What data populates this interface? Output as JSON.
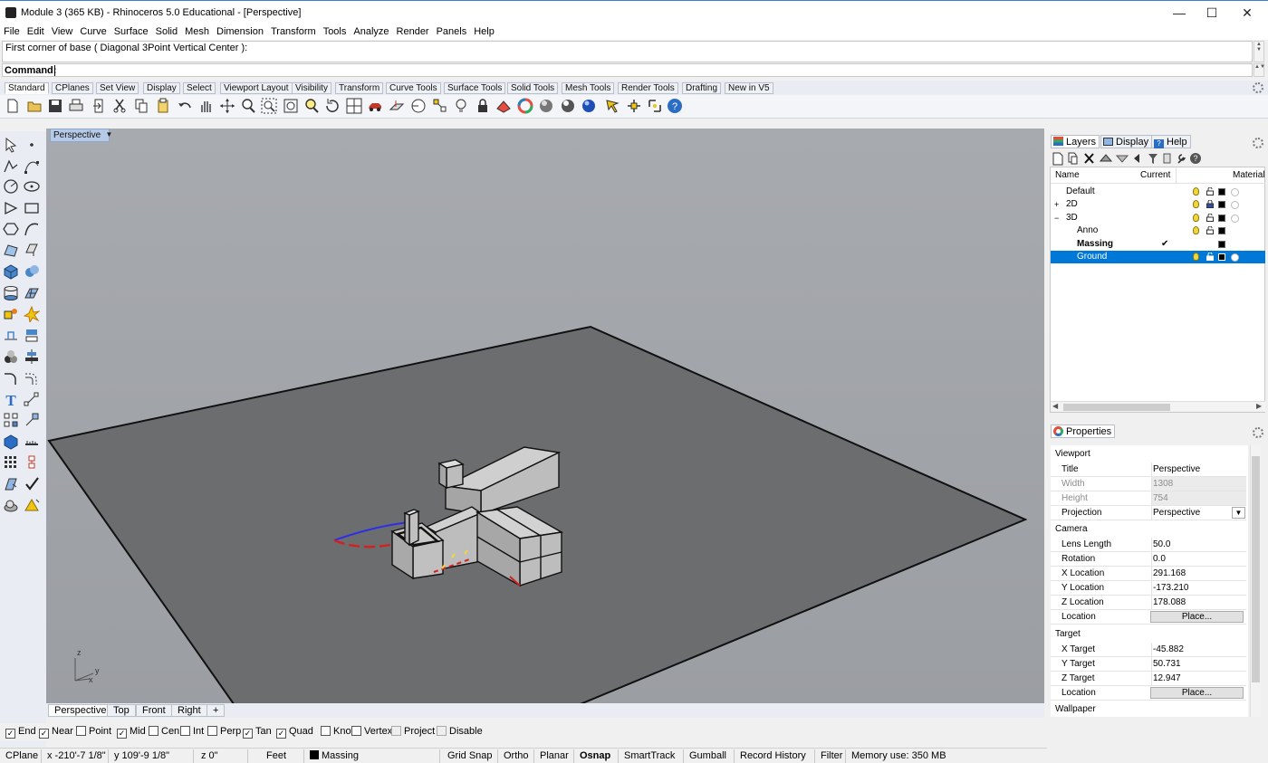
{
  "window": {
    "title": "Module 3 (365 KB) - Rhinoceros 5.0 Educational - [Perspective]",
    "minimize": "—",
    "maximize": "☐",
    "close": "✕"
  },
  "menu": [
    "File",
    "Edit",
    "View",
    "Curve",
    "Surface",
    "Solid",
    "Mesh",
    "Dimension",
    "Transform",
    "Tools",
    "Analyze",
    "Render",
    "Panels",
    "Help"
  ],
  "command": {
    "history": "First corner of base ( Diagonal  3Point  Vertical  Center ):",
    "label": "Command:"
  },
  "toolbar_tabs": [
    "Standard",
    "CPlanes",
    "Set View",
    "Display",
    "Select",
    "Viewport Layout",
    "Visibility",
    "Transform",
    "Curve Tools",
    "Surface Tools",
    "Solid Tools",
    "Mesh Tools",
    "Render Tools",
    "Drafting",
    "New in V5"
  ],
  "toolbar_icons": [
    "new-file-icon",
    "open-folder-icon",
    "save-icon",
    "print-icon",
    "import-icon",
    "cut-icon",
    "copy-icon",
    "paste-icon",
    "undo-icon",
    "pan-hand-icon",
    "rotate-view-icon",
    "zoom-dynamic-icon",
    "zoom-window-icon",
    "zoom-extents-icon",
    "zoom-selected-icon",
    "rotate-icon",
    "four-viewports-icon",
    "car-icon",
    "cplane-icon",
    "circle-point-icon",
    "object-snap-icon",
    "light-bulb-icon",
    "lock-icon",
    "render-preview-icon",
    "color-wheel-icon",
    "shaded-sphere-icon",
    "rendered-sphere-icon",
    "material-sphere-icon",
    "blue-sphere-icon",
    "arrow-pin-icon",
    "properties-icon",
    "options-icon",
    "help-icon"
  ],
  "viewport": {
    "label": "Perspective",
    "axes": {
      "z": "z",
      "y": "y",
      "x": "x"
    }
  },
  "viewport_tabs": [
    "Perspective",
    "Top",
    "Front",
    "Right"
  ],
  "viewport_tab_add": "+",
  "osnaps": [
    {
      "label": "End",
      "checked": true
    },
    {
      "label": "Near",
      "checked": true
    },
    {
      "label": "Point",
      "checked": false
    },
    {
      "label": "Mid",
      "checked": true
    },
    {
      "label": "Cen",
      "checked": false
    },
    {
      "label": "Int",
      "checked": false
    },
    {
      "label": "Perp",
      "checked": false
    },
    {
      "label": "Tan",
      "checked": true
    },
    {
      "label": "Quad",
      "checked": true
    },
    {
      "label": "Knot",
      "checked": false
    },
    {
      "label": "Vertex",
      "checked": false
    },
    {
      "label": "Project",
      "checked": false
    },
    {
      "label": "Disable",
      "checked": false
    }
  ],
  "status": {
    "cplane": "CPlane",
    "x": "x -210'-7 1/8\"",
    "y": "y 109'-9 1/8\"",
    "z": "z 0\"",
    "units": "Feet",
    "layer": "Massing",
    "grid_snap": "Grid Snap",
    "ortho": "Ortho",
    "planar": "Planar",
    "osnap": "Osnap",
    "smarttrack": "SmartTrack",
    "gumball": "Gumball",
    "record_history": "Record History",
    "filter": "Filter",
    "memory": "Memory use: 350 MB"
  },
  "layers_panel": {
    "tabs": [
      "Layers",
      "Display",
      "Help"
    ],
    "headers": {
      "name": "Name",
      "current": "Current",
      "material": "Material"
    },
    "rows": [
      {
        "name": "Default",
        "indent": 0,
        "expander": "",
        "current": "",
        "bold": false,
        "selected": false
      },
      {
        "name": "2D",
        "indent": 0,
        "expander": "+",
        "current": "",
        "bold": false,
        "selected": false
      },
      {
        "name": "3D",
        "indent": 0,
        "expander": "−",
        "current": "",
        "bold": false,
        "selected": false
      },
      {
        "name": "Anno",
        "indent": 1,
        "expander": "",
        "current": "",
        "bold": false,
        "selected": false
      },
      {
        "name": "Massing",
        "indent": 1,
        "expander": "",
        "current": "✔",
        "bold": true,
        "selected": false
      },
      {
        "name": "Ground",
        "indent": 1,
        "expander": "",
        "current": "",
        "bold": false,
        "selected": true
      }
    ]
  },
  "properties_panel": {
    "tab": "Properties",
    "sections": {
      "viewport": "Viewport",
      "camera": "Camera",
      "target": "Target",
      "wallpaper": "Wallpaper"
    },
    "viewport": {
      "title_label": "Title",
      "title": "Perspective",
      "width_label": "Width",
      "width": "1308",
      "height_label": "Height",
      "height": "754",
      "projection_label": "Projection",
      "projection": "Perspective"
    },
    "camera": {
      "lens_label": "Lens Length",
      "lens": "50.0",
      "rotation_label": "Rotation",
      "rotation": "0.0",
      "xloc_label": "X Location",
      "xloc": "291.168",
      "yloc_label": "Y Location",
      "yloc": "-173.210",
      "zloc_label": "Z Location",
      "zloc": "178.088",
      "loc_label": "Location",
      "place_btn": "Place..."
    },
    "target": {
      "x_label": "X Target",
      "x": "-45.882",
      "y_label": "Y Target",
      "y": "50.731",
      "z_label": "Z Target",
      "z": "12.947",
      "loc_label": "Location",
      "place_btn": "Place..."
    }
  },
  "colors": {
    "selection": "#0078d7",
    "viewport_bg": "#a3a6ab",
    "ground": "#6c6d6f"
  }
}
